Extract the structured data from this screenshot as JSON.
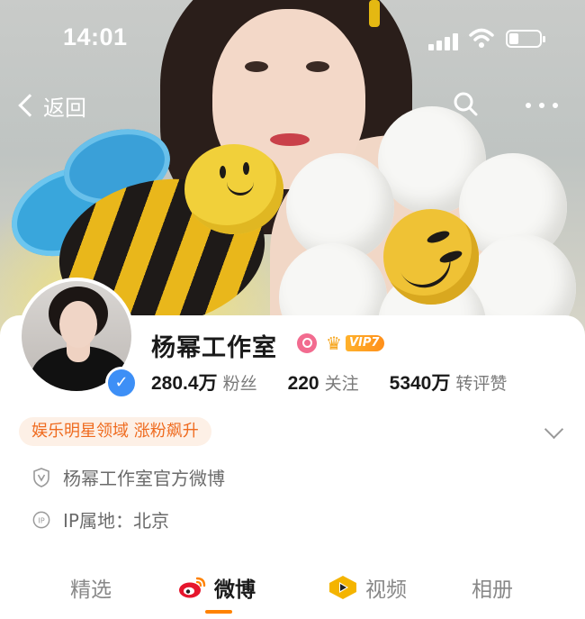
{
  "status_bar": {
    "time": "14:01"
  },
  "nav": {
    "back_label": "返回"
  },
  "profile": {
    "name": "杨幂工作室",
    "vip_label": "VIP7",
    "stats": [
      {
        "value": "280.4万",
        "label": "粉丝"
      },
      {
        "value": "220",
        "label": "关注"
      },
      {
        "value": "5340万",
        "label": "转评赞"
      }
    ],
    "tag": "娱乐明星领域 涨粉飙升",
    "verification": "杨幂工作室官方微博",
    "ip_location": "IP属地：北京"
  },
  "tabs": [
    {
      "label": "精选",
      "active": false
    },
    {
      "label": "微博",
      "active": true
    },
    {
      "label": "视频",
      "active": false
    },
    {
      "label": "相册",
      "active": false
    }
  ],
  "colors": {
    "accent": "#ff8200",
    "verified": "#3d8ff6",
    "tag_text": "#ef6b1f",
    "tag_bg": "#fdf0e6"
  }
}
